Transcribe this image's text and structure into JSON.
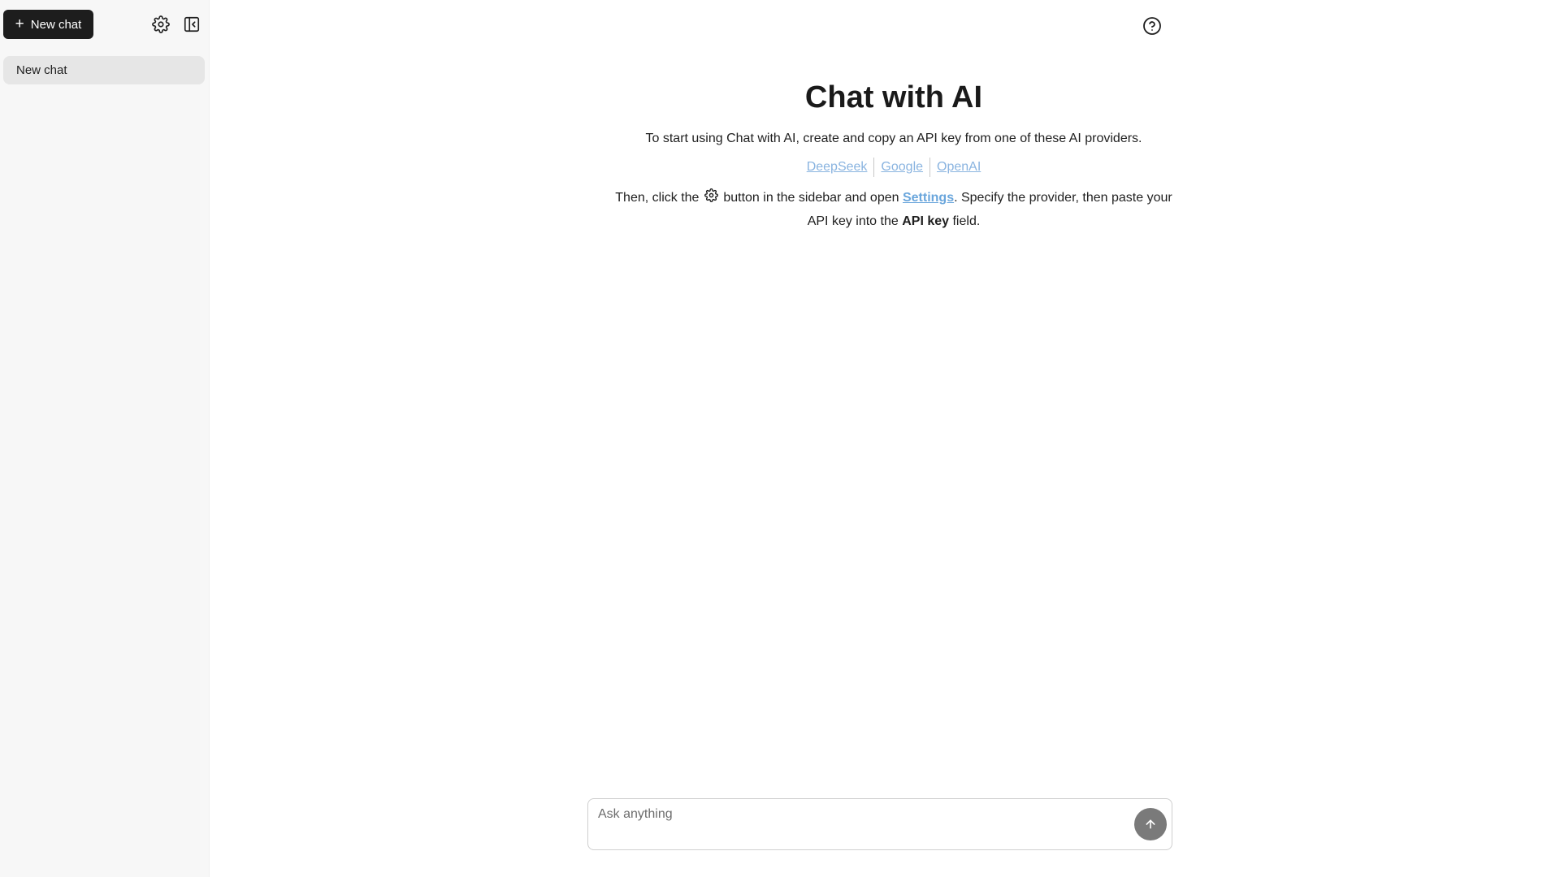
{
  "sidebar": {
    "new_chat_label": "New chat",
    "new_chat_icon": "plus-icon",
    "settings_icon": "gear-icon",
    "collapse_icon": "sidebar-collapse-icon",
    "chats": [
      {
        "label": "New chat",
        "selected": true
      }
    ]
  },
  "header": {
    "help_icon": "question-circle-icon"
  },
  "intro": {
    "title": "Chat with AI",
    "line1": "To start using Chat with AI, create and copy an API key from one of these AI providers.",
    "providers": [
      "DeepSeek",
      "Google",
      "OpenAI"
    ],
    "line3_part1": "Then, click the",
    "line3_part2": "button in the sidebar and open",
    "settings_link": "Settings",
    "line3_part3": ". Specify the provider, then paste your API key into the",
    "api_key_label": "API key",
    "line3_part4": "field."
  },
  "composer": {
    "placeholder": "Ask anything",
    "value": "",
    "send_icon": "arrow-up-icon"
  },
  "colors": {
    "sidebar_bg": "#f7f7f7",
    "selected_item_bg": "#e6e6e6",
    "primary_button_bg": "#1d1d1d",
    "link": "#8ab4e0",
    "send_button_bg": "#7a7a7a"
  }
}
